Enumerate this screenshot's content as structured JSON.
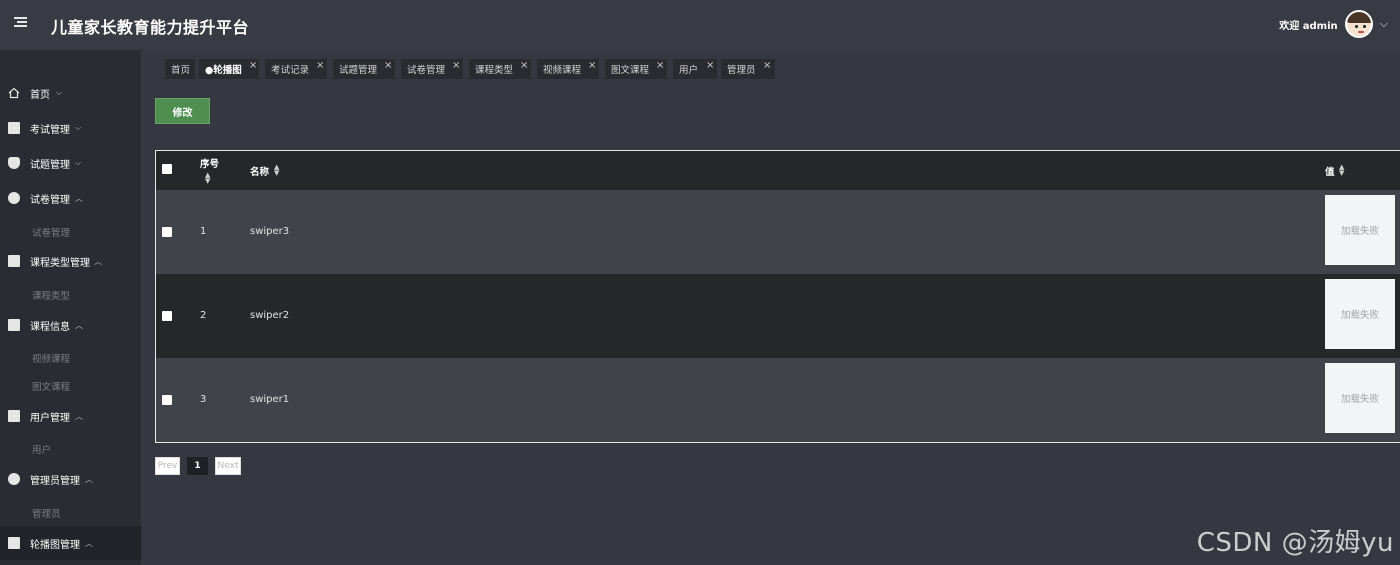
{
  "header": {
    "title": "儿童家长教育能力提升平台",
    "welcome": "欢迎 admin"
  },
  "sidebar": {
    "items": [
      {
        "label": "首页",
        "icon": "home-icon"
      },
      {
        "label": "考试管理",
        "icon": "exam-icon"
      },
      {
        "label": "试题管理",
        "icon": "question-icon"
      },
      {
        "label": "试卷管理",
        "icon": "paper-icon",
        "sub": [
          "试卷管理"
        ]
      },
      {
        "label": "课程类型管理",
        "icon": "course-type-icon",
        "sub": [
          "课程类型"
        ]
      },
      {
        "label": "课程信息",
        "icon": "course-info-icon",
        "sub": [
          "视频课程",
          "图文课程"
        ]
      },
      {
        "label": "用户管理",
        "icon": "user-icon",
        "sub": [
          "用户"
        ]
      },
      {
        "label": "管理员管理",
        "icon": "admin-icon",
        "sub": [
          "管理员"
        ]
      },
      {
        "label": "轮播图管理",
        "icon": "carousel-icon"
      }
    ]
  },
  "tabs": [
    "首页",
    "●轮播图",
    "考试记录",
    "试题管理",
    "试卷管理",
    "课程类型",
    "视频课程",
    "图文课程",
    "用户",
    "管理员"
  ],
  "actions": {
    "edit": "修改"
  },
  "table": {
    "columns": {
      "index": "序号",
      "name": "名称",
      "value": "值"
    },
    "rows": [
      {
        "index": "1",
        "name": "swiper3",
        "value": "加载失败"
      },
      {
        "index": "2",
        "name": "swiper2",
        "value": "加载失败"
      },
      {
        "index": "3",
        "name": "swiper1",
        "value": "加载失败"
      }
    ]
  },
  "pagination": {
    "prev": "Prev",
    "current": "1",
    "next": "Next"
  },
  "watermark": "CSDN @汤姆yu",
  "colors": {
    "header_bg": "#393b44",
    "sidebar_bg": "#2b2c33",
    "content_bg": "#353741",
    "edit_button": "#4e8e4f"
  }
}
